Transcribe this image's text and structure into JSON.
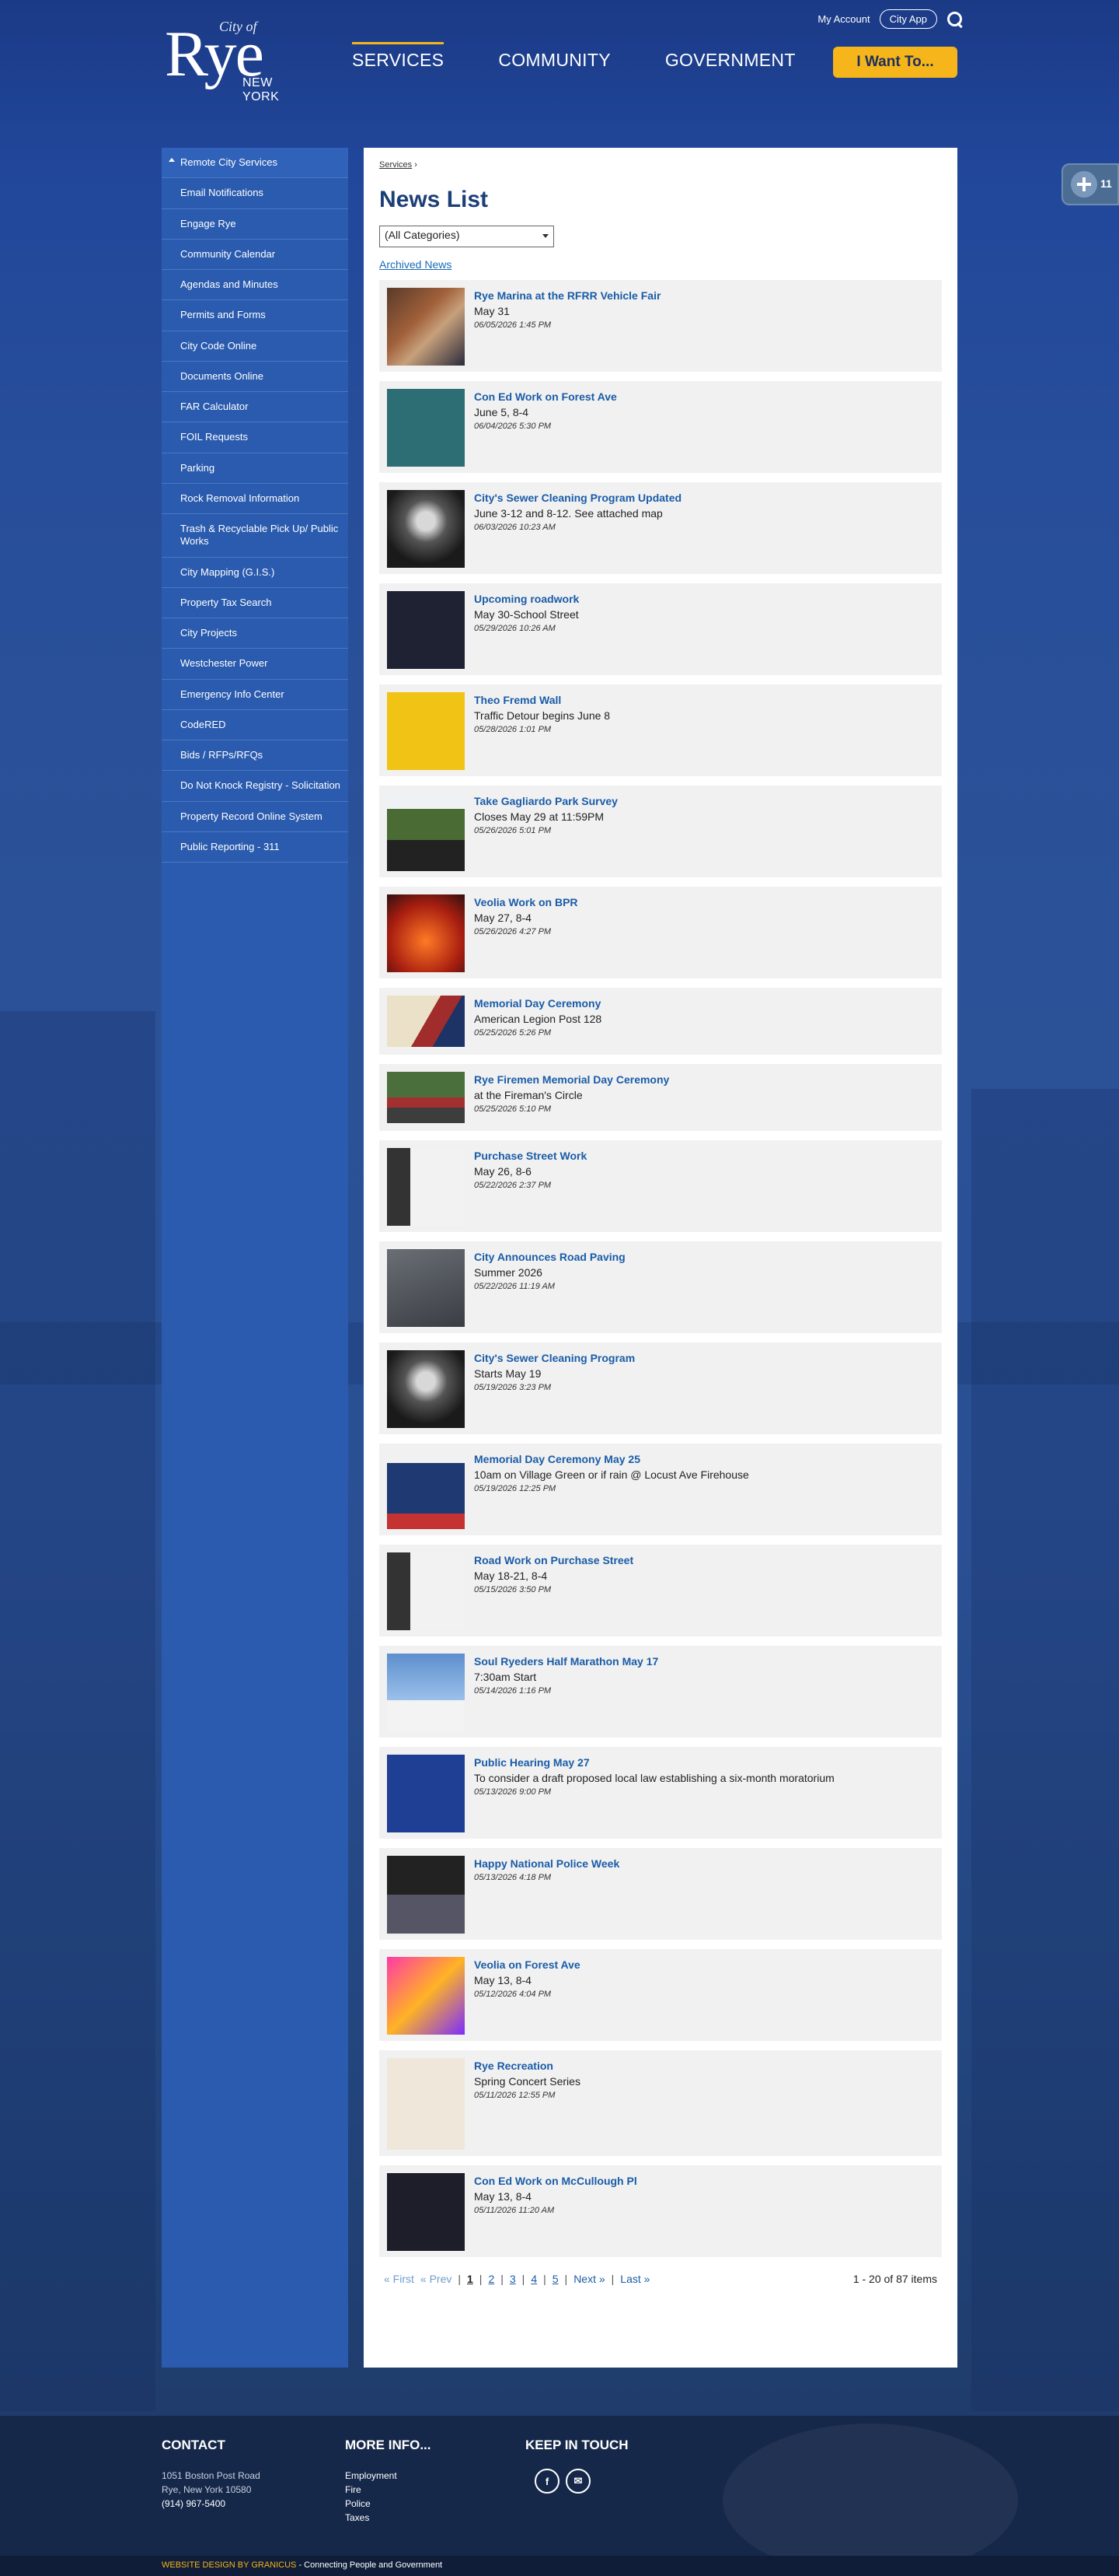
{
  "header": {
    "logo": {
      "city_of": "City of",
      "rye": "Rye",
      "state": "NEW YORK"
    },
    "my_account": "My Account",
    "city_app": "City App",
    "nav": [
      {
        "label": "SERVICES",
        "active": true
      },
      {
        "label": "COMMUNITY",
        "active": false
      },
      {
        "label": "GOVERNMENT",
        "active": false
      }
    ],
    "i_want_to": "I Want To..."
  },
  "sidebar": {
    "items": [
      "Remote City Services",
      "Email Notifications",
      "Engage Rye",
      "Community Calendar",
      "Agendas and Minutes",
      "Permits and Forms",
      "City Code Online",
      "Documents Online",
      "FAR Calculator",
      "FOIL Requests",
      "Parking",
      "Rock Removal Information",
      "Trash & Recyclable Pick Up/ Public Works",
      "City Mapping (G.I.S.)",
      "Property Tax Search",
      "City Projects",
      "Westchester Power",
      "Emergency Info Center",
      "CodeRED",
      "Bids / RFPs/RFQs",
      "Do Not Knock Registry - Solicitation",
      "Property Record Online System",
      "Public Reporting - 311"
    ]
  },
  "main": {
    "breadcrumb": {
      "link": "Services",
      "sep": "›"
    },
    "title": "News List",
    "category_select": "(All Categories)",
    "archived_link": "Archived News",
    "news": [
      {
        "title": "Rye Marina at the RFRR Vehicle Fair",
        "subtitle": "May 31",
        "date": "06/05/2026 1:45 PM",
        "thumb": "marina"
      },
      {
        "title": "Con Ed Work on Forest Ave",
        "subtitle": "June 5, 8-4",
        "date": "06/04/2026 5:30 PM",
        "thumb": "coned"
      },
      {
        "title": "City's Sewer Cleaning Program Updated",
        "subtitle": "June 3-12 and 8-12. See attached map",
        "date": "06/03/2026 10:23 AM",
        "thumb": "sewer"
      },
      {
        "title": "Upcoming roadwork",
        "subtitle": "May 30-School Street",
        "date": "05/29/2026 10:26 AM",
        "thumb": "road"
      },
      {
        "title": "Theo Fremd Wall",
        "subtitle": "Traffic Detour begins June 8",
        "date": "05/28/2026 1:01 PM",
        "thumb": "theo"
      },
      {
        "title": "Take Gagliardo Park Survey",
        "subtitle": "Closes May 29 at 11:59PM",
        "date": "05/26/2026 5:01 PM",
        "thumb": "park"
      },
      {
        "title": "Veolia Work on BPR",
        "subtitle": "May 27, 8-4",
        "date": "05/26/2026 4:27 PM",
        "thumb": "veolia"
      },
      {
        "title": "Memorial Day Ceremony",
        "subtitle": "American Legion Post 128",
        "date": "05/25/2026 5:26 PM",
        "thumb": "memorial",
        "short": true
      },
      {
        "title": "Rye Firemen Memorial Day Ceremony",
        "subtitle": "at the Fireman's Circle",
        "date": "05/25/2026 5:10 PM",
        "thumb": "firemen",
        "short": true
      },
      {
        "title": "Purchase Street Work",
        "subtitle": "May 26, 8-6",
        "date": "05/22/2026 2:37 PM",
        "thumb": "purchase"
      },
      {
        "title": "City Announces Road Paving",
        "subtitle": "Summer 2026",
        "date": "05/22/2026 11:19 AM",
        "thumb": "paving"
      },
      {
        "title": "City's Sewer Cleaning Program",
        "subtitle": "Starts May 19",
        "date": "05/19/2026 3:23 PM",
        "thumb": "sewer"
      },
      {
        "title": "Memorial Day Ceremony May 25",
        "subtitle": "10am on Village Green or if rain @ Locust Ave Firehouse",
        "date": "05/19/2026 12:25 PM",
        "thumb": "veiled"
      },
      {
        "title": "Road Work on Purchase Street",
        "subtitle": "May 18-21, 8-4",
        "date": "05/15/2026 3:50 PM",
        "thumb": "purchase"
      },
      {
        "title": "Soul Ryeders Half Marathon May 17",
        "subtitle": "7:30am Start",
        "date": "05/14/2026 1:16 PM",
        "thumb": "soul"
      },
      {
        "title": "Public Hearing May 27",
        "subtitle": "To consider a draft proposed local law establishing a six-month moratorium",
        "date": "05/13/2026 9:00 PM",
        "thumb": "hearing"
      },
      {
        "title": "Happy National Police Week",
        "subtitle": "",
        "date": "05/13/2026 4:18 PM",
        "thumb": "police"
      },
      {
        "title": "Veolia on Forest Ave",
        "subtitle": "May 13, 8-4",
        "date": "05/12/2026 4:04 PM",
        "thumb": "veolia2"
      },
      {
        "title": "Rye Recreation",
        "subtitle": "Spring Concert Series",
        "date": "05/11/2026 12:55 PM",
        "thumb": "rec",
        "tall": true
      },
      {
        "title": "Con Ed Work on McCullough Pl",
        "subtitle": "May 13, 8-4",
        "date": "05/11/2026 11:20 AM",
        "thumb": "coned2"
      }
    ],
    "pager": {
      "first": "« First",
      "prev": "« Prev",
      "pages": [
        "1",
        "2",
        "3",
        "4",
        "5"
      ],
      "current": "1",
      "next": "Next »",
      "last": "Last »",
      "count": "1 - 20 of 87 items"
    }
  },
  "float_tab": {
    "label": "11"
  },
  "footer": {
    "contact_title": "CONTACT",
    "address1": "1051 Boston Post Road",
    "address2": "Rye, New York 10580",
    "phone": "(914) 967-5400",
    "more_title": "MORE INFO...",
    "more_links": [
      "Employment",
      "Fire",
      "Police",
      "Taxes"
    ],
    "keep_title": "KEEP IN TOUCH",
    "social": [
      {
        "icon": "facebook-icon",
        "glyph": "f"
      },
      {
        "icon": "email-icon",
        "glyph": "✉"
      }
    ],
    "credit": "WEBSITE DESIGN BY GRANICUS",
    "tagline": " - Connecting People and Government"
  }
}
